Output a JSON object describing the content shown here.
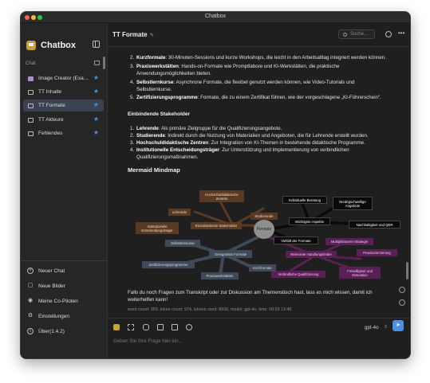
{
  "window": {
    "title": "Chatbox"
  },
  "sidebar": {
    "app_name": "Chatbox",
    "section_label": "Chat",
    "chats": [
      {
        "label": "Image Creator (Exam...",
        "starred": true,
        "icon": "image-creator-icon"
      },
      {
        "label": "TT Inhalte",
        "starred": true,
        "icon": "chat-icon"
      },
      {
        "label": "TT Formate",
        "starred": true,
        "icon": "chat-icon",
        "active": true
      },
      {
        "label": "TT Akteure",
        "starred": true,
        "icon": "chat-icon"
      },
      {
        "label": "Fehlendes",
        "starred": true,
        "icon": "chat-icon"
      }
    ],
    "menu": [
      {
        "label": "Neuer Chat",
        "icon": "plus-circle-icon"
      },
      {
        "label": "Neue Bilder",
        "icon": "image-icon"
      },
      {
        "label": "Meine Co-Piloten",
        "icon": "copilot-icon"
      },
      {
        "label": "Einstellungen",
        "icon": "gear-icon"
      },
      {
        "label": "Über(1.4.2)",
        "icon": "info-icon"
      }
    ]
  },
  "header": {
    "title": "TT Formate",
    "search_placeholder": "Suche..."
  },
  "message": {
    "list1": [
      {
        "n": "2.",
        "bold": "Kurzformate",
        "text": ": 30-Minuten-Sessions und kurze Workshops, die leicht in den Arbeitsalltag integriert werden können.",
        "cont": ""
      },
      {
        "n": "3.",
        "bold": "Praxiswerkstätten",
        "text": ": Hands-on-Formate wie Promptlabore und KI-Werkstätten, die praktische",
        "cont": "Anwendungsmöglichkeiten bieten."
      },
      {
        "n": "4.",
        "bold": "Selbstlernkurse",
        "text": ": Asynchrone Formate, die flexibel genutzt werden können, wie Video-Tutorials und",
        "cont": "Selbstlernkurse."
      },
      {
        "n": "5.",
        "bold": "Zertifizierungsprogramme",
        "text": ": Formate, die zu einem Zertifikat führen, wie der vorgeschlagene „KI-Führerschein“.",
        "cont": ""
      }
    ],
    "stakeholder_heading": "Einbindende Stakeholder",
    "list2": [
      {
        "n": "1.",
        "bold": "Lehrende",
        "text": ": Als primäre Zielgruppe für die Qualifizierungsangebote.",
        "cont": ""
      },
      {
        "n": "2.",
        "bold": "Studierende",
        "text": ": Indirekt durch die Nutzung von Materialien und Angeboten, die für Lehrende erstellt wurden.",
        "cont": ""
      },
      {
        "n": "3.",
        "bold": "Hochschuldidaktische Zentren",
        "text": ": Zur Integration von KI-Themen in bestehende didaktische Programme.",
        "cont": ""
      },
      {
        "n": "4.",
        "bold": "Institutionelle Entscheidungsträger",
        "text": ": Zur Unterstützung und Implementierung von verbindlichen",
        "cont": "Qualifizierungsmaßnahmen."
      }
    ],
    "mindmap_heading": "Mermaid Mindmap",
    "closing_line1": "Falls du noch Fragen zum Transkript oder zur Diskussion am Themenstisch hast, lass es mich wissen, damit ich",
    "closing_line2": "weiterhelfen kann!",
    "stats": "word count: 359, token count: 974, tokens used: 8936, model: gpt-4o, time: 09:03 13:48"
  },
  "mindmap": {
    "center": "Formate",
    "nodes": [
      "Hochschuldidaktische Zentren",
      "Lehrende",
      "Studierende",
      "Institutionelle Entscheidungsträger",
      "Einzubindende Stakeholder",
      "Individuelle Beratung",
      "Niedrigschwellige Angebote",
      "Wichtigste Aspekte",
      "Nachhaltigkeit und QER",
      "Vielfalt der Formate",
      "Multiplikatoren-Strategie",
      "Relevante Handlungsfelder",
      "Praxisorientierung",
      "Verbindliche Qualifizierung",
      "Freiwilligkeit und Motivation",
      "Selbstlernkurse",
      "Geeignetste Formate",
      "Zertifizierungsprogramme",
      "Praxiswerkstätten",
      "Kurzformate"
    ]
  },
  "composer": {
    "placeholder": "Geben Sie Ihre Frage hier ein...",
    "model": "gpt-4o"
  }
}
